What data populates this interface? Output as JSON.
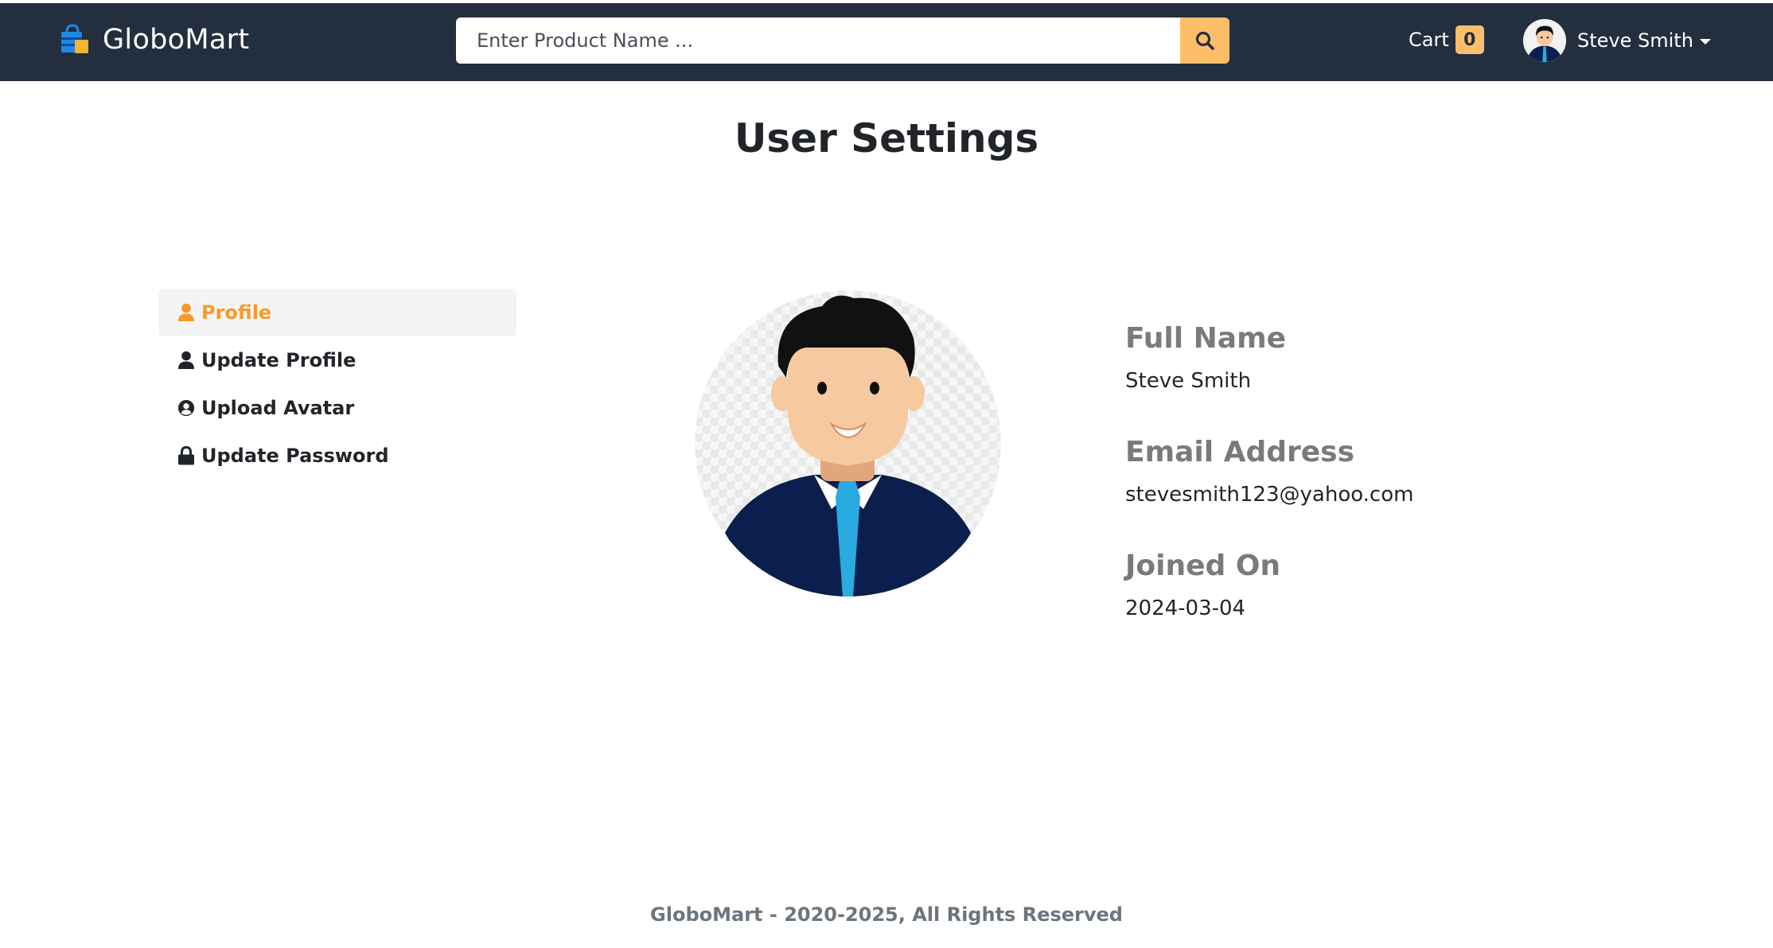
{
  "navbar": {
    "brand": "GloboMart",
    "search_placeholder": "Enter Product Name ...",
    "cart_label": "Cart",
    "cart_count": "0",
    "user_name": "Steve Smith",
    "colors": {
      "navbar_bg": "#232f3e",
      "accent": "#febd69"
    }
  },
  "page": {
    "title": "User Settings"
  },
  "sidebar": {
    "items": [
      {
        "label": "Profile",
        "icon": "user-icon",
        "active": true
      },
      {
        "label": "Update Profile",
        "icon": "user-icon",
        "active": false
      },
      {
        "label": "Upload Avatar",
        "icon": "user-circle-icon",
        "active": false
      },
      {
        "label": "Update Password",
        "icon": "lock-icon",
        "active": false
      }
    ],
    "active_color": "#f89a2a"
  },
  "profile": {
    "fields": [
      {
        "label": "Full Name",
        "value": "Steve Smith"
      },
      {
        "label": "Email Address",
        "value": "stevesmith123@yahoo.com"
      },
      {
        "label": "Joined On",
        "value": "2024-03-04"
      }
    ]
  },
  "footer": {
    "text": "GloboMart - 2020-2025, All Rights Reserved"
  }
}
